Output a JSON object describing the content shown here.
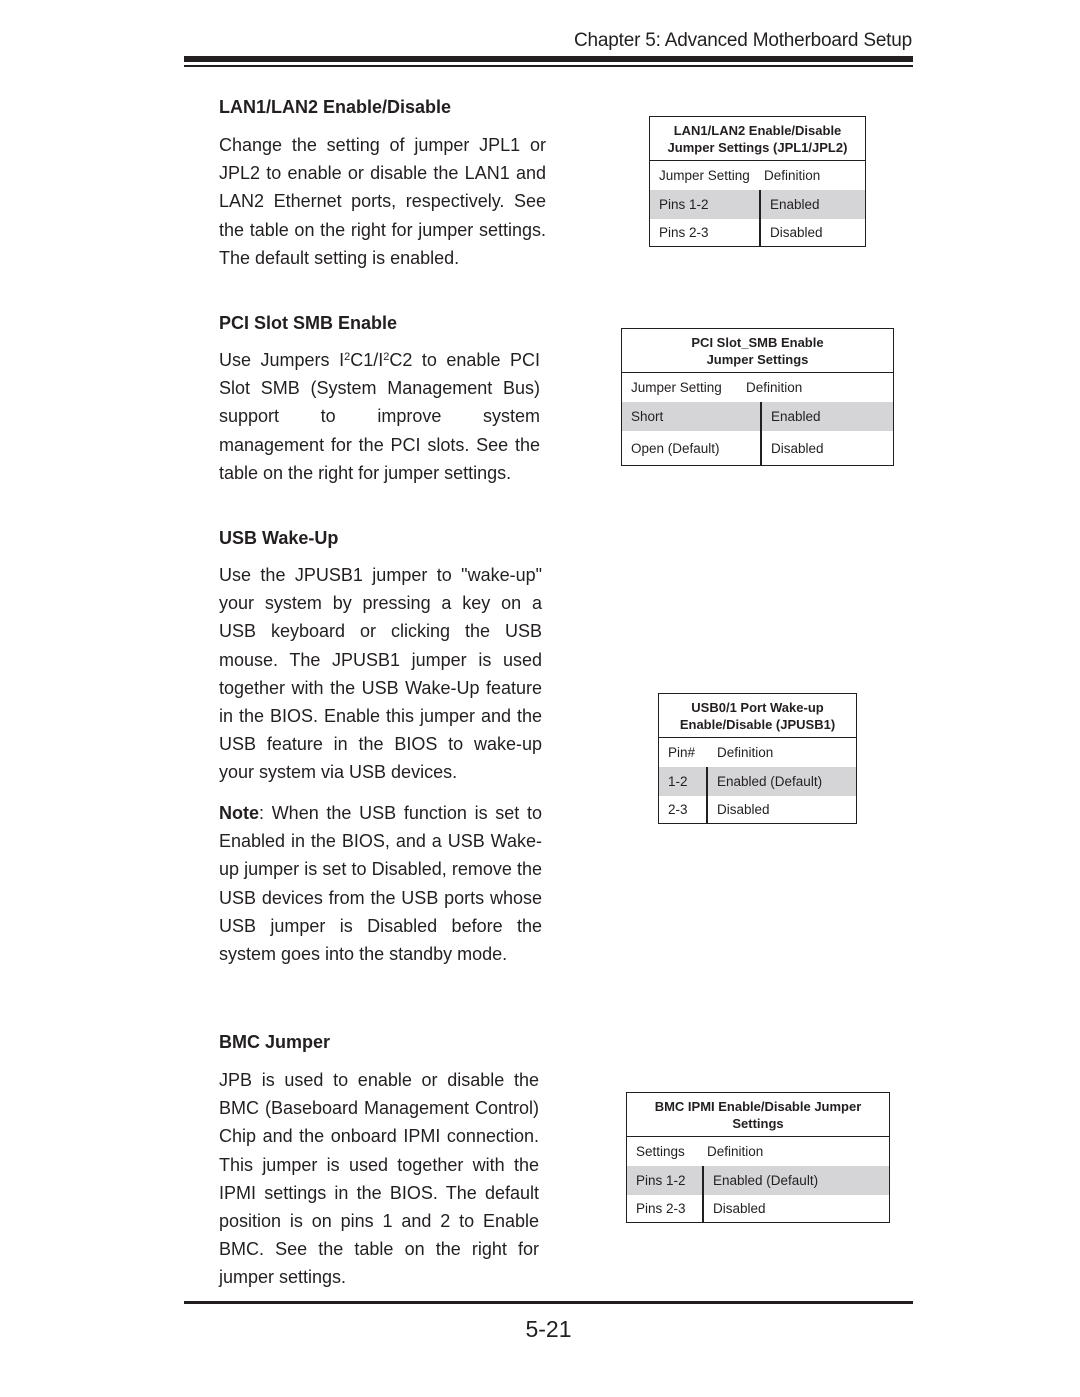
{
  "header": {
    "chapter": "Chapter 5: Advanced Motherboard Setup"
  },
  "footer": {
    "page_number": "5-21"
  },
  "sections": [
    {
      "title": "LAN1/LAN2 Enable/Disable",
      "body": "Change the setting of jumper JPL1 or JPL2 to enable or disable the LAN1 and LAN2 Ethernet ports, respectively. See the table on the right for jumper settings. The default setting is enabled."
    },
    {
      "title": "PCI Slot SMB Enable",
      "body_prefix": "Use Jumpers I",
      "sup1": "2",
      "body_mid": "C1/I",
      "sup2": "2",
      "body_suffix": "C2 to enable PCI Slot SMB (System Management Bus) support to improve system management for the PCI slots. See the table on the right for jumper settings."
    },
    {
      "title": "USB Wake-Up",
      "body": "Use the JPUSB1 jumper to \"wake-up\" your system by pressing a key on a USB keyboard or clicking the USB mouse. The JPUSB1 jumper is used together with the USB Wake-Up feature in the BIOS. Enable this jumper and the USB feature in the BIOS to wake-up your system via USB devices.",
      "note_label": "Note",
      "note_body": ": When the USB function is set to Enabled in the BIOS, and a USB Wake-up jumper is set to Disabled, remove the USB devices from the USB ports whose USB jumper is Disabled before the system goes into the standby mode."
    },
    {
      "title": "BMC Jumper",
      "body": "JPB is used to enable or disable the BMC (Baseboard Management Control) Chip and the onboard IPMI connection. This jumper is used together with the IPMI settings in the BIOS. The default position is on pins 1 and 2 to Enable BMC. See the table on the right for jumper settings."
    }
  ],
  "tables": [
    {
      "title_line1": "LAN1/LAN2 Enable/Disable",
      "title_line2": "Jumper Settings (JPL1/JPL2)",
      "headers": [
        "Jumper Setting",
        "Definition"
      ],
      "rows": [
        [
          "Pins 1-2",
          "Enabled"
        ],
        [
          "Pins 2-3",
          "Disabled"
        ]
      ]
    },
    {
      "title_line1": "PCI Slot_SMB Enable",
      "title_line2": "Jumper Settings",
      "headers": [
        "Jumper Setting",
        "Definition"
      ],
      "rows": [
        [
          "Short",
          "Enabled"
        ],
        [
          "Open (Default)",
          "Disabled"
        ]
      ]
    },
    {
      "title_line1": "USB0/1 Port Wake-up",
      "title_line2": "Enable/Disable (JPUSB1)",
      "headers": [
        "Pin#",
        "Definition"
      ],
      "rows": [
        [
          "1-2",
          "Enabled (Default)"
        ],
        [
          "2-3",
          "Disabled"
        ]
      ]
    },
    {
      "title_line1": "BMC IPMI Enable/Disable Jumper",
      "title_line2": "Settings",
      "headers": [
        "Settings",
        "Definition"
      ],
      "rows": [
        [
          "Pins 1-2",
          "Enabled (Default)"
        ],
        [
          "Pins 2-3",
          "Disabled"
        ]
      ]
    }
  ],
  "colors": {
    "text": "#231f20",
    "shaded_row": "#d5d5d7"
  }
}
